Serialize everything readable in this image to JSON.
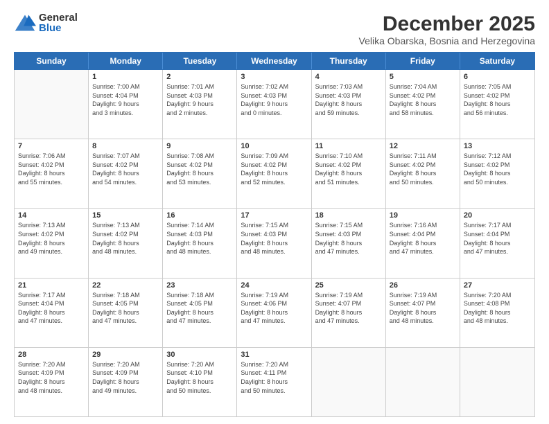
{
  "logo": {
    "general": "General",
    "blue": "Blue"
  },
  "title": "December 2025",
  "location": "Velika Obarska, Bosnia and Herzegovina",
  "header_days": [
    "Sunday",
    "Monday",
    "Tuesday",
    "Wednesday",
    "Thursday",
    "Friday",
    "Saturday"
  ],
  "weeks": [
    [
      {
        "day": "",
        "info": ""
      },
      {
        "day": "1",
        "info": "Sunrise: 7:00 AM\nSunset: 4:04 PM\nDaylight: 9 hours\nand 3 minutes."
      },
      {
        "day": "2",
        "info": "Sunrise: 7:01 AM\nSunset: 4:03 PM\nDaylight: 9 hours\nand 2 minutes."
      },
      {
        "day": "3",
        "info": "Sunrise: 7:02 AM\nSunset: 4:03 PM\nDaylight: 9 hours\nand 0 minutes."
      },
      {
        "day": "4",
        "info": "Sunrise: 7:03 AM\nSunset: 4:03 PM\nDaylight: 8 hours\nand 59 minutes."
      },
      {
        "day": "5",
        "info": "Sunrise: 7:04 AM\nSunset: 4:02 PM\nDaylight: 8 hours\nand 58 minutes."
      },
      {
        "day": "6",
        "info": "Sunrise: 7:05 AM\nSunset: 4:02 PM\nDaylight: 8 hours\nand 56 minutes."
      }
    ],
    [
      {
        "day": "7",
        "info": "Sunrise: 7:06 AM\nSunset: 4:02 PM\nDaylight: 8 hours\nand 55 minutes."
      },
      {
        "day": "8",
        "info": "Sunrise: 7:07 AM\nSunset: 4:02 PM\nDaylight: 8 hours\nand 54 minutes."
      },
      {
        "day": "9",
        "info": "Sunrise: 7:08 AM\nSunset: 4:02 PM\nDaylight: 8 hours\nand 53 minutes."
      },
      {
        "day": "10",
        "info": "Sunrise: 7:09 AM\nSunset: 4:02 PM\nDaylight: 8 hours\nand 52 minutes."
      },
      {
        "day": "11",
        "info": "Sunrise: 7:10 AM\nSunset: 4:02 PM\nDaylight: 8 hours\nand 51 minutes."
      },
      {
        "day": "12",
        "info": "Sunrise: 7:11 AM\nSunset: 4:02 PM\nDaylight: 8 hours\nand 50 minutes."
      },
      {
        "day": "13",
        "info": "Sunrise: 7:12 AM\nSunset: 4:02 PM\nDaylight: 8 hours\nand 50 minutes."
      }
    ],
    [
      {
        "day": "14",
        "info": "Sunrise: 7:13 AM\nSunset: 4:02 PM\nDaylight: 8 hours\nand 49 minutes."
      },
      {
        "day": "15",
        "info": "Sunrise: 7:13 AM\nSunset: 4:02 PM\nDaylight: 8 hours\nand 48 minutes."
      },
      {
        "day": "16",
        "info": "Sunrise: 7:14 AM\nSunset: 4:03 PM\nDaylight: 8 hours\nand 48 minutes."
      },
      {
        "day": "17",
        "info": "Sunrise: 7:15 AM\nSunset: 4:03 PM\nDaylight: 8 hours\nand 48 minutes."
      },
      {
        "day": "18",
        "info": "Sunrise: 7:15 AM\nSunset: 4:03 PM\nDaylight: 8 hours\nand 47 minutes."
      },
      {
        "day": "19",
        "info": "Sunrise: 7:16 AM\nSunset: 4:04 PM\nDaylight: 8 hours\nand 47 minutes."
      },
      {
        "day": "20",
        "info": "Sunrise: 7:17 AM\nSunset: 4:04 PM\nDaylight: 8 hours\nand 47 minutes."
      }
    ],
    [
      {
        "day": "21",
        "info": "Sunrise: 7:17 AM\nSunset: 4:04 PM\nDaylight: 8 hours\nand 47 minutes."
      },
      {
        "day": "22",
        "info": "Sunrise: 7:18 AM\nSunset: 4:05 PM\nDaylight: 8 hours\nand 47 minutes."
      },
      {
        "day": "23",
        "info": "Sunrise: 7:18 AM\nSunset: 4:05 PM\nDaylight: 8 hours\nand 47 minutes."
      },
      {
        "day": "24",
        "info": "Sunrise: 7:19 AM\nSunset: 4:06 PM\nDaylight: 8 hours\nand 47 minutes."
      },
      {
        "day": "25",
        "info": "Sunrise: 7:19 AM\nSunset: 4:07 PM\nDaylight: 8 hours\nand 47 minutes."
      },
      {
        "day": "26",
        "info": "Sunrise: 7:19 AM\nSunset: 4:07 PM\nDaylight: 8 hours\nand 48 minutes."
      },
      {
        "day": "27",
        "info": "Sunrise: 7:20 AM\nSunset: 4:08 PM\nDaylight: 8 hours\nand 48 minutes."
      }
    ],
    [
      {
        "day": "28",
        "info": "Sunrise: 7:20 AM\nSunset: 4:09 PM\nDaylight: 8 hours\nand 48 minutes."
      },
      {
        "day": "29",
        "info": "Sunrise: 7:20 AM\nSunset: 4:09 PM\nDaylight: 8 hours\nand 49 minutes."
      },
      {
        "day": "30",
        "info": "Sunrise: 7:20 AM\nSunset: 4:10 PM\nDaylight: 8 hours\nand 50 minutes."
      },
      {
        "day": "31",
        "info": "Sunrise: 7:20 AM\nSunset: 4:11 PM\nDaylight: 8 hours\nand 50 minutes."
      },
      {
        "day": "",
        "info": ""
      },
      {
        "day": "",
        "info": ""
      },
      {
        "day": "",
        "info": ""
      }
    ]
  ]
}
